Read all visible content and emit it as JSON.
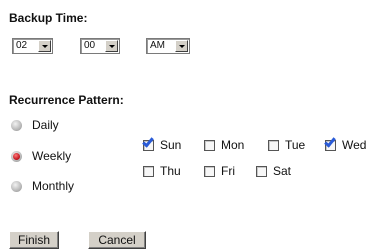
{
  "backup_time": {
    "heading": "Backup Time:",
    "hour": "02",
    "minute": "00",
    "ampm": "AM"
  },
  "recurrence": {
    "heading": "Recurrence Pattern:",
    "options": [
      {
        "label": "Daily",
        "selected": false
      },
      {
        "label": "Weekly",
        "selected": true
      },
      {
        "label": "Monthly",
        "selected": false
      }
    ],
    "days": [
      {
        "label": "Sun",
        "checked": true
      },
      {
        "label": "Mon",
        "checked": false
      },
      {
        "label": "Tue",
        "checked": false
      },
      {
        "label": "Wed",
        "checked": true
      },
      {
        "label": "Thu",
        "checked": false
      },
      {
        "label": "Fri",
        "checked": false
      },
      {
        "label": "Sat",
        "checked": false
      }
    ]
  },
  "buttons": {
    "finish": "Finish",
    "cancel": "Cancel"
  }
}
